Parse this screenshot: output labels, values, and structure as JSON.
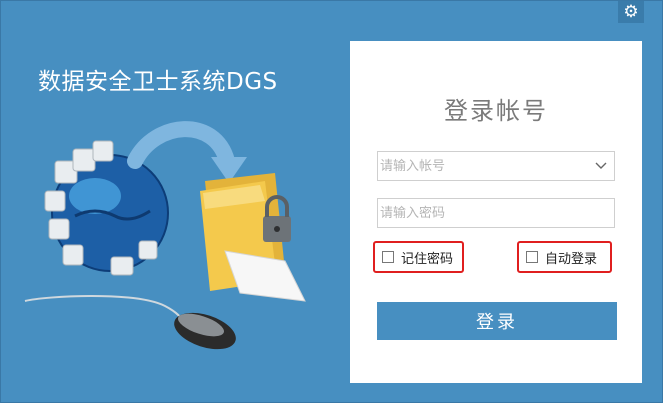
{
  "app": {
    "title": "数据安全卫士系统DGS"
  },
  "login": {
    "heading": "登录帐号",
    "account_placeholder": "请输入帐号",
    "password_placeholder": "请输入密码",
    "remember_label": "记住密码",
    "autologin_label": "自动登录",
    "login_button": "登录"
  },
  "icons": {
    "settings": "gear-icon",
    "dropdown": "chevron-down-icon"
  },
  "colors": {
    "background": "#478fc1",
    "panel": "#ffffff",
    "highlight_border": "#e01f1f",
    "button": "#478fc1"
  }
}
